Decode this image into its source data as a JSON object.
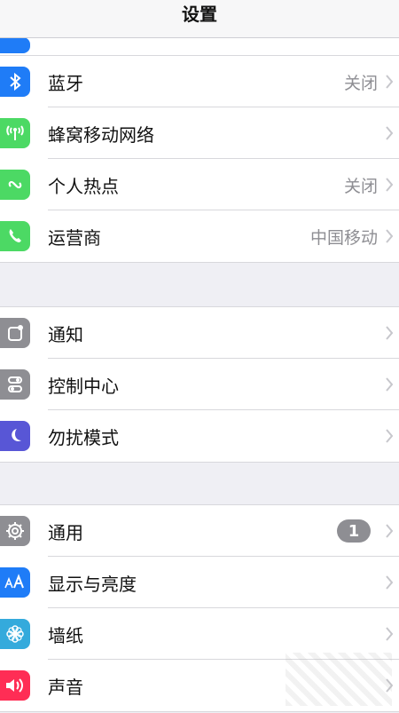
{
  "nav": {
    "title": "设置"
  },
  "group1": {
    "rows": [
      {
        "label": "蓝牙",
        "value": "关闭"
      },
      {
        "label": "蜂窝移动网络",
        "value": ""
      },
      {
        "label": "个人热点",
        "value": "关闭"
      },
      {
        "label": "运营商",
        "value": "中国移动"
      }
    ]
  },
  "group2": {
    "rows": [
      {
        "label": "通知"
      },
      {
        "label": "控制中心"
      },
      {
        "label": "勿扰模式"
      }
    ]
  },
  "group3": {
    "rows": [
      {
        "label": "通用",
        "badge": "1"
      },
      {
        "label": "显示与亮度"
      },
      {
        "label": "墙纸"
      },
      {
        "label": "声音"
      }
    ]
  },
  "colors": {
    "bluetooth": "#1f7cf7",
    "cellular": "#4cd964",
    "hotspot": "#4cd964",
    "carrier": "#4cd964",
    "notifications": "#8e8e93",
    "control_center": "#8e8e93",
    "dnd": "#5856d6",
    "general": "#8e8e93",
    "display": "#1f7cf7",
    "wallpaper": "#34aadc",
    "sounds": "#ff2d55"
  }
}
